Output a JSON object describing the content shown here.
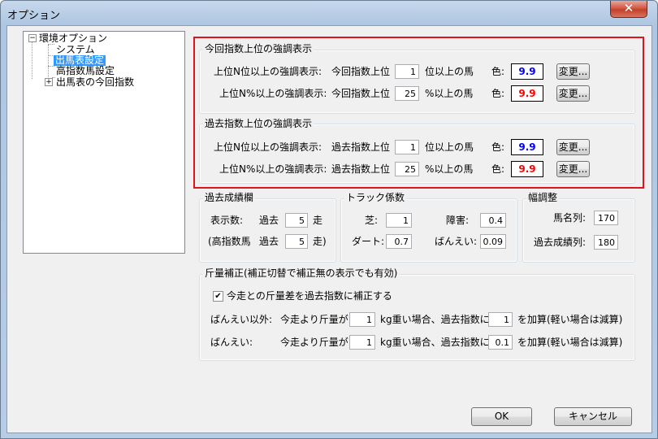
{
  "window": {
    "title": "オプション",
    "close_label": "✕"
  },
  "tree": {
    "root": "環境オプション",
    "items": [
      "システム",
      "出馬表設定",
      "高指数馬設定",
      "出馬表の今回指数"
    ],
    "expand_root": "−",
    "expand_last": "+"
  },
  "konkai": {
    "title": "今回指数上位の強調表示",
    "row1": {
      "label": "上位N位以上の強調表示:",
      "prefix": "今回指数上位",
      "value": "1",
      "suffix": "位以上の馬",
      "color_label": "色:",
      "swatch": "9.9",
      "swatch_color": "#0000ff",
      "button": "変更..."
    },
    "row2": {
      "label": "上位N%以上の強調表示:",
      "prefix": "今回指数上位",
      "value": "25",
      "suffix": "%以上の馬",
      "color_label": "色:",
      "swatch": "9.9",
      "swatch_color": "#ff0000",
      "button": "変更..."
    }
  },
  "kako": {
    "title": "過去指数上位の強調表示",
    "row1": {
      "label": "上位N位以上の強調表示:",
      "prefix": "過去指数上位",
      "value": "1",
      "suffix": "位以上の馬",
      "color_label": "色:",
      "swatch": "9.9",
      "swatch_color": "#0000ff",
      "button": "変更..."
    },
    "row2": {
      "label": "上位N%以上の強調表示:",
      "prefix": "過去指数上位",
      "value": "25",
      "suffix": "%以上の馬",
      "color_label": "色:",
      "swatch": "9.9",
      "swatch_color": "#ff0000",
      "button": "変更..."
    }
  },
  "kako_seiseki": {
    "title": "過去成績欄",
    "row1": {
      "label": "表示数:",
      "prefix": "過去",
      "value": "5",
      "suffix": "走"
    },
    "row2": {
      "label": "(高指数馬",
      "prefix": "過去",
      "value": "5",
      "suffix": "走)"
    }
  },
  "track": {
    "title": "トラック係数",
    "shiba_label": "芝:",
    "shiba_value": "1",
    "shogai_label": "障害:",
    "shogai_value": "0.4",
    "dirt_label": "ダート:",
    "dirt_value": "0.7",
    "banei_label": "ばんえい:",
    "banei_value": "0.09"
  },
  "haba": {
    "title": "幅調整",
    "bamei_label": "馬名列:",
    "bamei_value": "170",
    "kako_label": "過去成績列:",
    "kako_value": "180"
  },
  "kinryo": {
    "title": "斤量補正(補正切替で補正無の表示でも有効)",
    "checkbox_label": "今走との斤量差を過去指数に補正する",
    "checked": true,
    "row1": {
      "label": "ばんえい以外:",
      "t1": "今走より斤量が",
      "v1": "1",
      "t2": "kg重い場合、過去指数に",
      "v2": "1",
      "t3": "を加算(軽い場合は減算)"
    },
    "row2": {
      "label": "ばんえい:",
      "t1": "今走より斤量が",
      "v1": "1",
      "t2": "kg重い場合、過去指数に",
      "v2": "0.1",
      "t3": "を加算(軽い場合は減算)"
    }
  },
  "buttons": {
    "ok": "OK",
    "cancel": "キャンセル"
  }
}
